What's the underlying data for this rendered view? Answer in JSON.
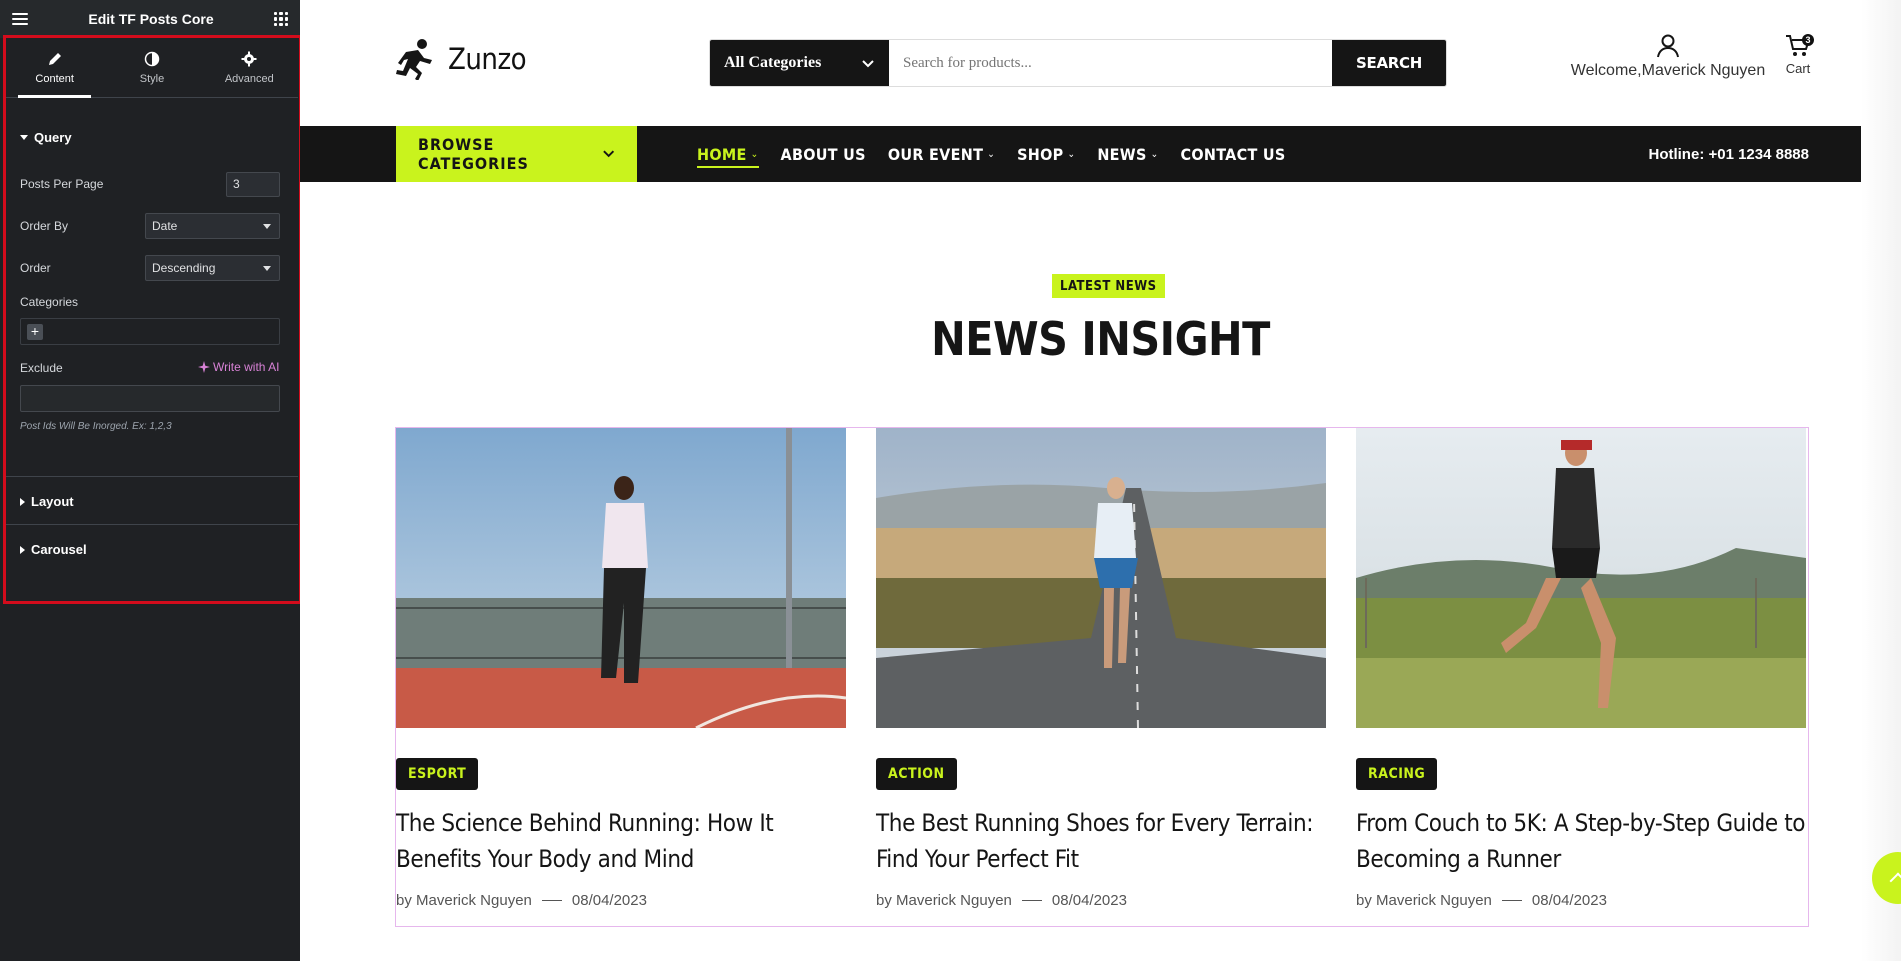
{
  "editor": {
    "title": "Edit TF Posts Core",
    "tabs": [
      {
        "label": "Content",
        "icon": "pencil-icon"
      },
      {
        "label": "Style",
        "icon": "half-circle-icon"
      },
      {
        "label": "Advanced",
        "icon": "gear-icon"
      }
    ],
    "query": {
      "heading": "Query",
      "posts_per_page_label": "Posts Per Page",
      "posts_per_page_value": "3",
      "order_by_label": "Order By",
      "order_by_value": "Date",
      "order_label": "Order",
      "order_value": "Descending",
      "categories_label": "Categories",
      "exclude_label": "Exclude",
      "write_ai": "Write with AI",
      "help_text": "Post Ids Will Be Inorged. Ex: 1,2,3"
    },
    "layout_heading": "Layout",
    "carousel_heading": "Carousel"
  },
  "site": {
    "brand": "Zunzo",
    "search": {
      "category": "All Categories",
      "placeholder": "Search for products...",
      "button": "SEARCH"
    },
    "account_text": "Welcome,Maverick Nguyen",
    "cart_label": "Cart",
    "cart_count": "3",
    "browse_label": "BROWSE CATEGORIES",
    "nav": [
      {
        "label": "HOME",
        "has_dropdown": true
      },
      {
        "label": "ABOUT US",
        "has_dropdown": false
      },
      {
        "label": "OUR EVENT",
        "has_dropdown": true
      },
      {
        "label": "SHOP",
        "has_dropdown": true
      },
      {
        "label": "NEWS",
        "has_dropdown": true
      },
      {
        "label": "CONTACT US",
        "has_dropdown": false
      }
    ],
    "hotline": "Hotline: +01 1234 8888",
    "section_tag": "LATEST NEWS",
    "section_title": "NEWS INSIGHT",
    "posts": [
      {
        "category": "ESPORT",
        "title": "The Science Behind Running: How It Benefits Your Body and Mind",
        "author": "by Maverick Nguyen",
        "date": "08/04/2023"
      },
      {
        "category": "ACTION",
        "title": "The Best Running Shoes for Every Terrain: Find Your Perfect Fit",
        "author": "by Maverick Nguyen",
        "date": "08/04/2023"
      },
      {
        "category": "RACING",
        "title": "From Couch to 5K: A Step-by-Step Guide to Becoming a Runner",
        "author": "by Maverick Nguyen",
        "date": "08/04/2023"
      }
    ]
  },
  "colors": {
    "accent": "#c9f31d",
    "dark": "#151515",
    "panel": "#1f2124",
    "highlight": "#d30c1c"
  }
}
